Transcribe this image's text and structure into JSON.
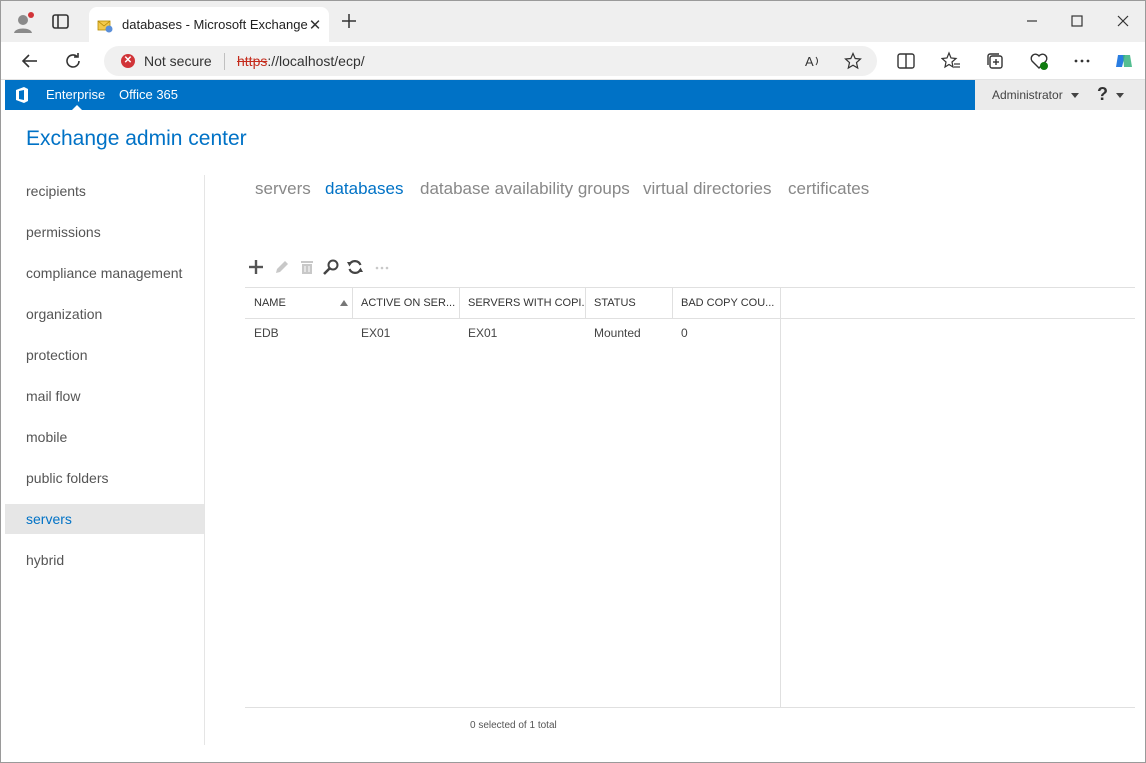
{
  "browser": {
    "tab_title": "databases - Microsoft Exchange",
    "tab_close": "✕",
    "security_label": "Not secure",
    "url_scheme": "https",
    "url_rest": "://localhost/ecp/"
  },
  "header": {
    "links": [
      "Enterprise",
      "Office 365"
    ],
    "user": "Administrator",
    "help": "?"
  },
  "app_title": "Exchange admin center",
  "nav": {
    "items": [
      "recipients",
      "permissions",
      "compliance management",
      "organization",
      "protection",
      "mail flow",
      "mobile",
      "public folders",
      "servers",
      "hybrid"
    ],
    "active": "servers"
  },
  "subtabs": {
    "items": [
      "servers",
      "databases",
      "database availability groups",
      "virtual directories",
      "certificates"
    ],
    "active": "databases"
  },
  "grid_toolbar": [
    "add-icon",
    "edit-icon",
    "delete-icon",
    "search-icon",
    "refresh-icon",
    "more-icon"
  ],
  "grid": {
    "columns": [
      "NAME",
      "ACTIVE ON SER...",
      "SERVERS WITH COPI...",
      "STATUS",
      "BAD COPY COU..."
    ],
    "rows": [
      [
        "EDB",
        "EX01",
        "EX01",
        "Mounted",
        "0"
      ]
    ],
    "status": "0 selected of 1 total"
  },
  "colors": {
    "accent": "#0072c6",
    "error": "#d13438"
  }
}
